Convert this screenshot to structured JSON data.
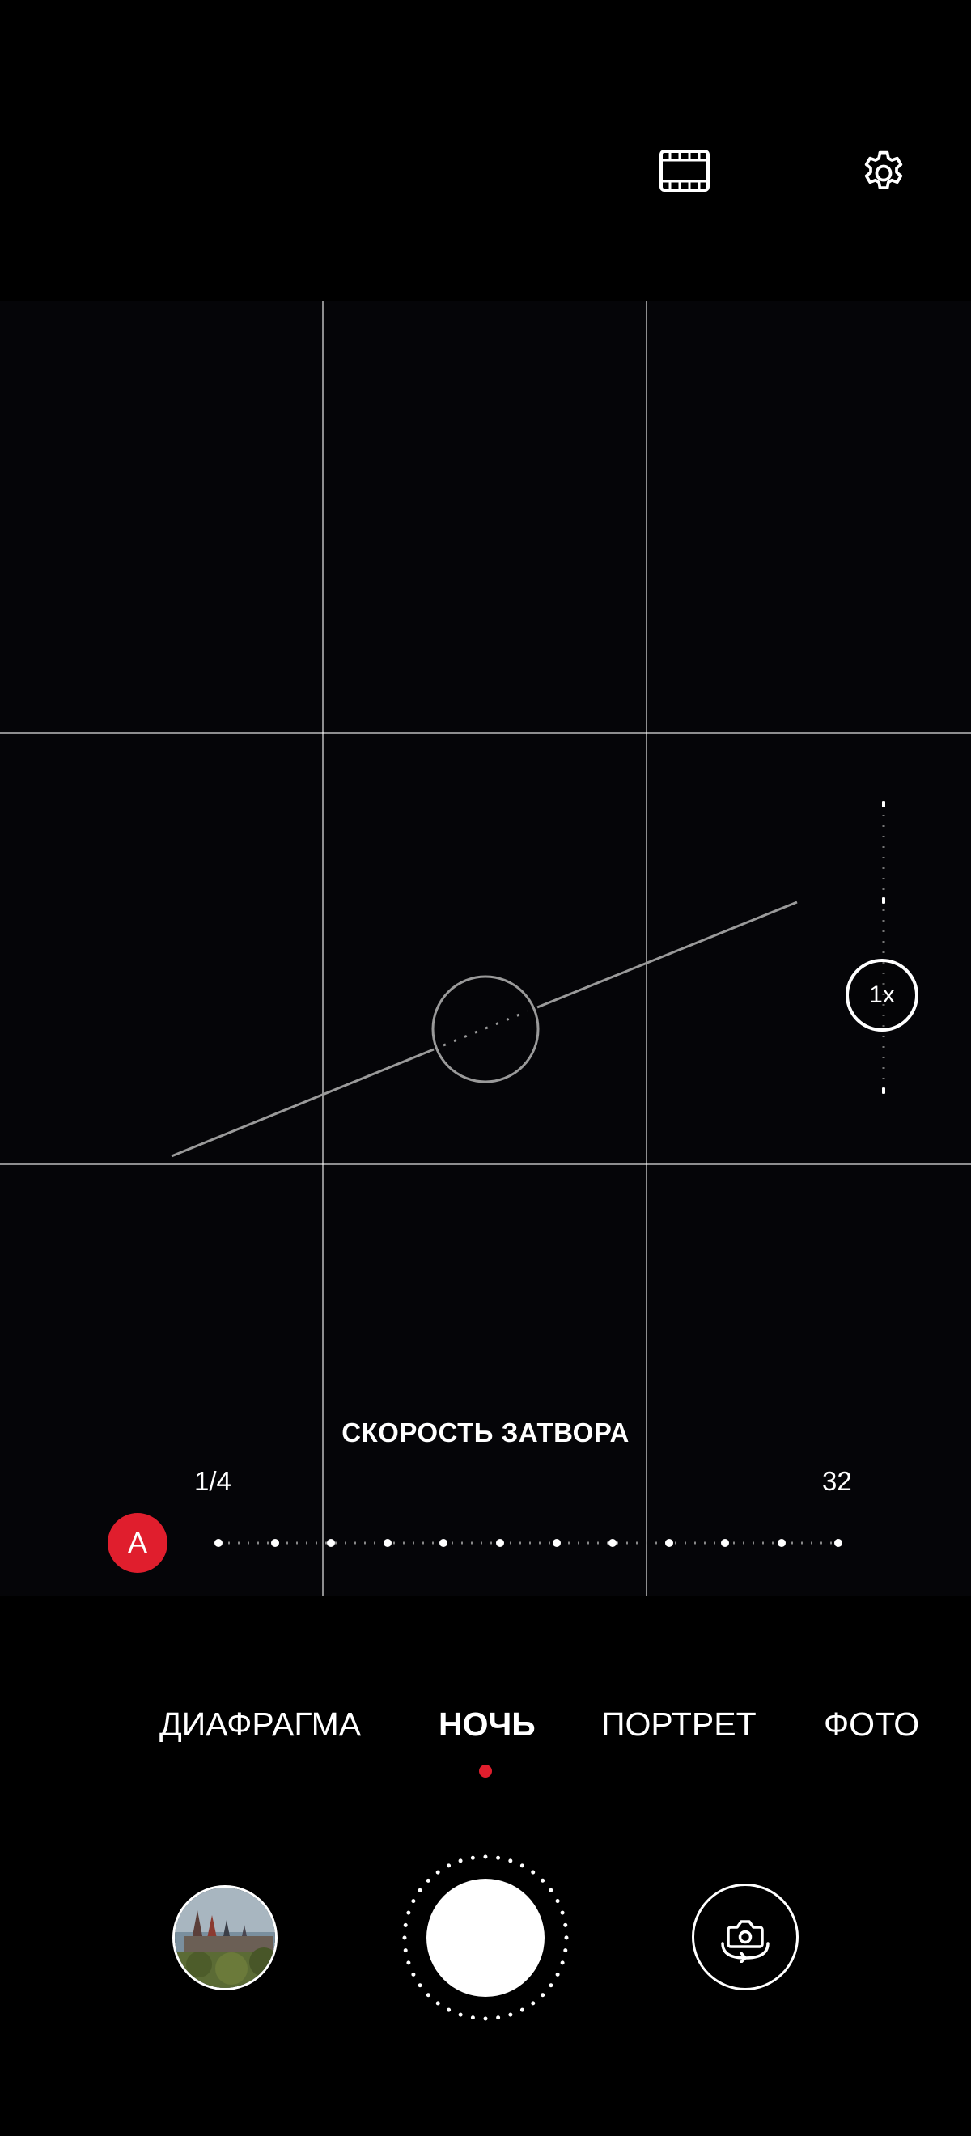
{
  "top_bar": {
    "film_icon": "film-strip-icon",
    "settings_icon": "gear-icon"
  },
  "viewfinder": {
    "zoom": {
      "label": "1x"
    }
  },
  "shutter_speed": {
    "title": "СКОРОСТЬ ЗАТВОРА",
    "auto_label": "A",
    "min_label": "1/4",
    "max_label": "32"
  },
  "modes": [
    {
      "label": "ДИАФРАГМА",
      "active": false
    },
    {
      "label": "НОЧЬ",
      "active": true
    },
    {
      "label": "ПОРТРЕТ",
      "active": false
    },
    {
      "label": "ФОТО",
      "active": false
    }
  ],
  "bottom": {
    "gallery_icon": "gallery-thumbnail",
    "shutter_icon": "shutter-button",
    "switch_camera_icon": "switch-camera-icon"
  },
  "colors": {
    "accent_red": "#e01e2d",
    "background": "#000000"
  }
}
